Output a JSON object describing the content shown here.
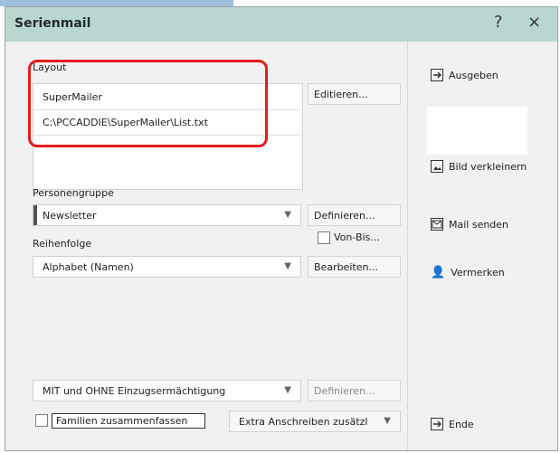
{
  "window": {
    "title": "Serienmail",
    "help_label": "?",
    "close_label": "×"
  },
  "layout": {
    "label": "Layout",
    "items": [
      "SuperMailer",
      "C:\\PCCADDIE\\SuperMailer\\List.txt"
    ],
    "edit_button": "Editieren..."
  },
  "personengruppe": {
    "label": "Personengruppe",
    "selected": "Newsletter",
    "define_button": "Definieren...",
    "von_bis_label": "Von-Bis..."
  },
  "reihenfolge": {
    "label": "Reihenfolge",
    "selected": "Alphabet (Namen)",
    "edit_button": "Bearbeiten..."
  },
  "einzug": {
    "selected": "MIT und OHNE Einzugsermächtigung",
    "define_button": "Definieren..."
  },
  "familien": {
    "label": "Familien zusammenfassen"
  },
  "extra": {
    "selected": "Extra Anschreiben zusätzl"
  },
  "right_buttons": {
    "ausgeben": "Ausgeben",
    "bild_verkleinern": "Bild verkleinern",
    "mail_senden": "Mail senden",
    "vermerken": "Vermerken",
    "ende": "Ende"
  }
}
